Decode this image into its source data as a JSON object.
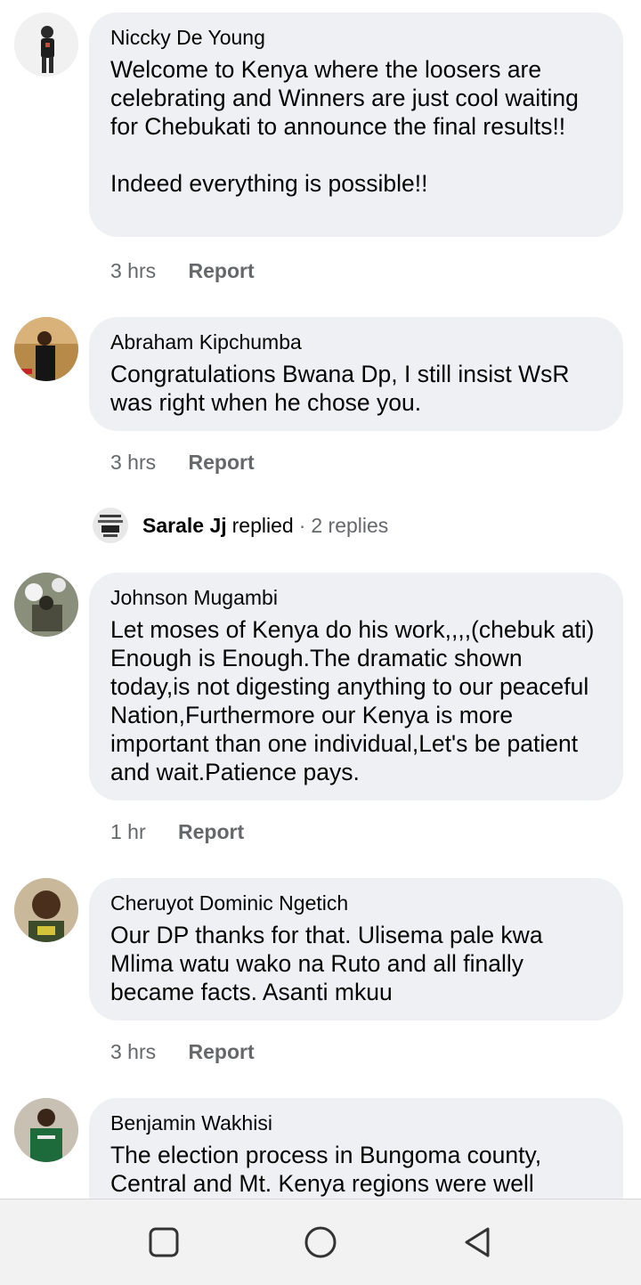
{
  "comments": [
    {
      "author": "Niccky De Young",
      "text": "Welcome to Kenya where the loosers are celebrating and Winners are just cool waiting for Chebukati to announce the final results!!\n\nIndeed everything is possible!!",
      "time": "3 hrs",
      "report": "Report"
    },
    {
      "author": "Abraham Kipchumba",
      "text": "Congratulations Bwana Dp, I still insist WsR was right when he chose you.",
      "time": "3 hrs",
      "report": "Report"
    },
    {
      "author": "Johnson Mugambi",
      "text": "Let moses of Kenya do his work,,,,(chebuk ati) Enough is Enough.The dramatic shown today,is not digesting anything to our peaceful Nation,Furthermore our Kenya is more important than one individual,Let's be patient and wait.Patience pays.",
      "time": "1 hr",
      "report": "Report"
    },
    {
      "author": "Cheruyot Dominic Ngetich",
      "text": "Our DP thanks for that. Ulisema pale kwa Mlima watu wako na Ruto and all finally became facts. Asanti mkuu",
      "time": "3 hrs",
      "report": "Report"
    },
    {
      "author": "Benjamin Wakhisi",
      "text": "The election process in Bungoma county, Central and Mt. Kenya regions were well"
    }
  ],
  "reply_summary": {
    "name": "Sarale Jj",
    "action": "replied",
    "separator": "·",
    "count": "2 replies"
  },
  "navbar": {
    "icons": [
      "recent-apps-icon",
      "home-icon",
      "back-icon"
    ]
  },
  "colors": {
    "bubble": "#eff0f4",
    "meta_text": "#65676b",
    "navbar": "#f2f2f2"
  }
}
